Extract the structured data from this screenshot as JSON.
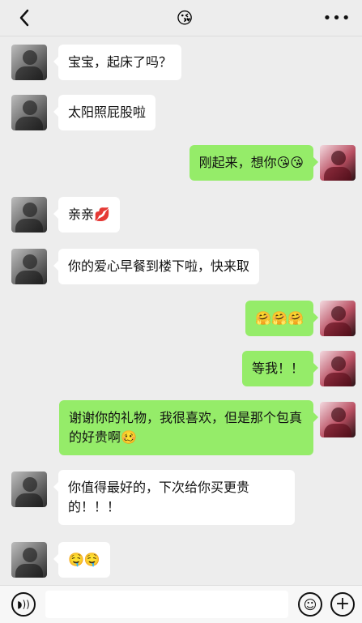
{
  "header": {
    "back_icon": "chevron-left-icon",
    "title_emoji": "😘",
    "more_label": "•••"
  },
  "messages": [
    {
      "side": "left",
      "text": "宝宝，起床了吗？"
    },
    {
      "side": "left",
      "text": "太阳照屁股啦"
    },
    {
      "side": "right",
      "text": "刚起来，想你😘😘"
    },
    {
      "side": "left",
      "text": "亲亲💋"
    },
    {
      "side": "left",
      "text": "你的爱心早餐到楼下啦，快来取"
    },
    {
      "side": "right",
      "text": "🤗🤗🤗"
    },
    {
      "side": "right",
      "text": "等我！！"
    },
    {
      "side": "right",
      "text": "谢谢你的礼物，我很喜欢，但是那个包真的好贵啊🥴"
    },
    {
      "side": "left",
      "text": "你值得最好的，下次给你买更贵的！！！"
    },
    {
      "side": "left",
      "text": "🤤🤤"
    }
  ],
  "input_bar": {
    "voice_icon": "voice-icon",
    "input_value": "",
    "emoji_icon": "smiley-icon",
    "plus_icon": "plus-icon",
    "voice_glyph": "◗))",
    "emoji_glyph": "☺",
    "plus_glyph": "+"
  }
}
